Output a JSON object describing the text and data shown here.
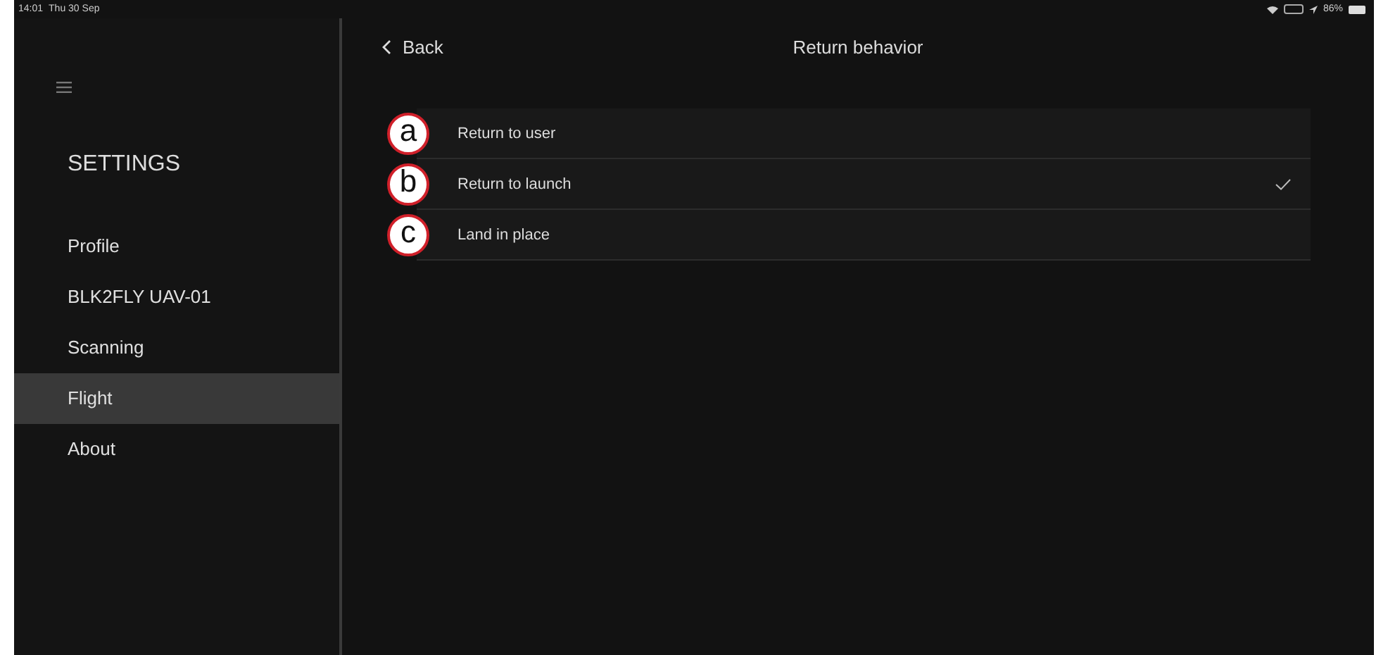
{
  "status_bar": {
    "time": "14:01",
    "date": "Thu 30 Sep",
    "battery": "86%"
  },
  "sidebar": {
    "title": "SETTINGS",
    "items": [
      {
        "label": "Profile",
        "selected": false
      },
      {
        "label": "BLK2FLY UAV-01",
        "selected": false
      },
      {
        "label": "Scanning",
        "selected": false
      },
      {
        "label": "Flight",
        "selected": true
      },
      {
        "label": "About",
        "selected": false
      }
    ]
  },
  "header": {
    "back": "Back",
    "title": "Return behavior"
  },
  "options": [
    {
      "callout": "a",
      "label": "Return to user",
      "checked": false
    },
    {
      "callout": "b",
      "label": "Return to launch",
      "checked": true
    },
    {
      "callout": "c",
      "label": "Land in place",
      "checked": false
    }
  ]
}
